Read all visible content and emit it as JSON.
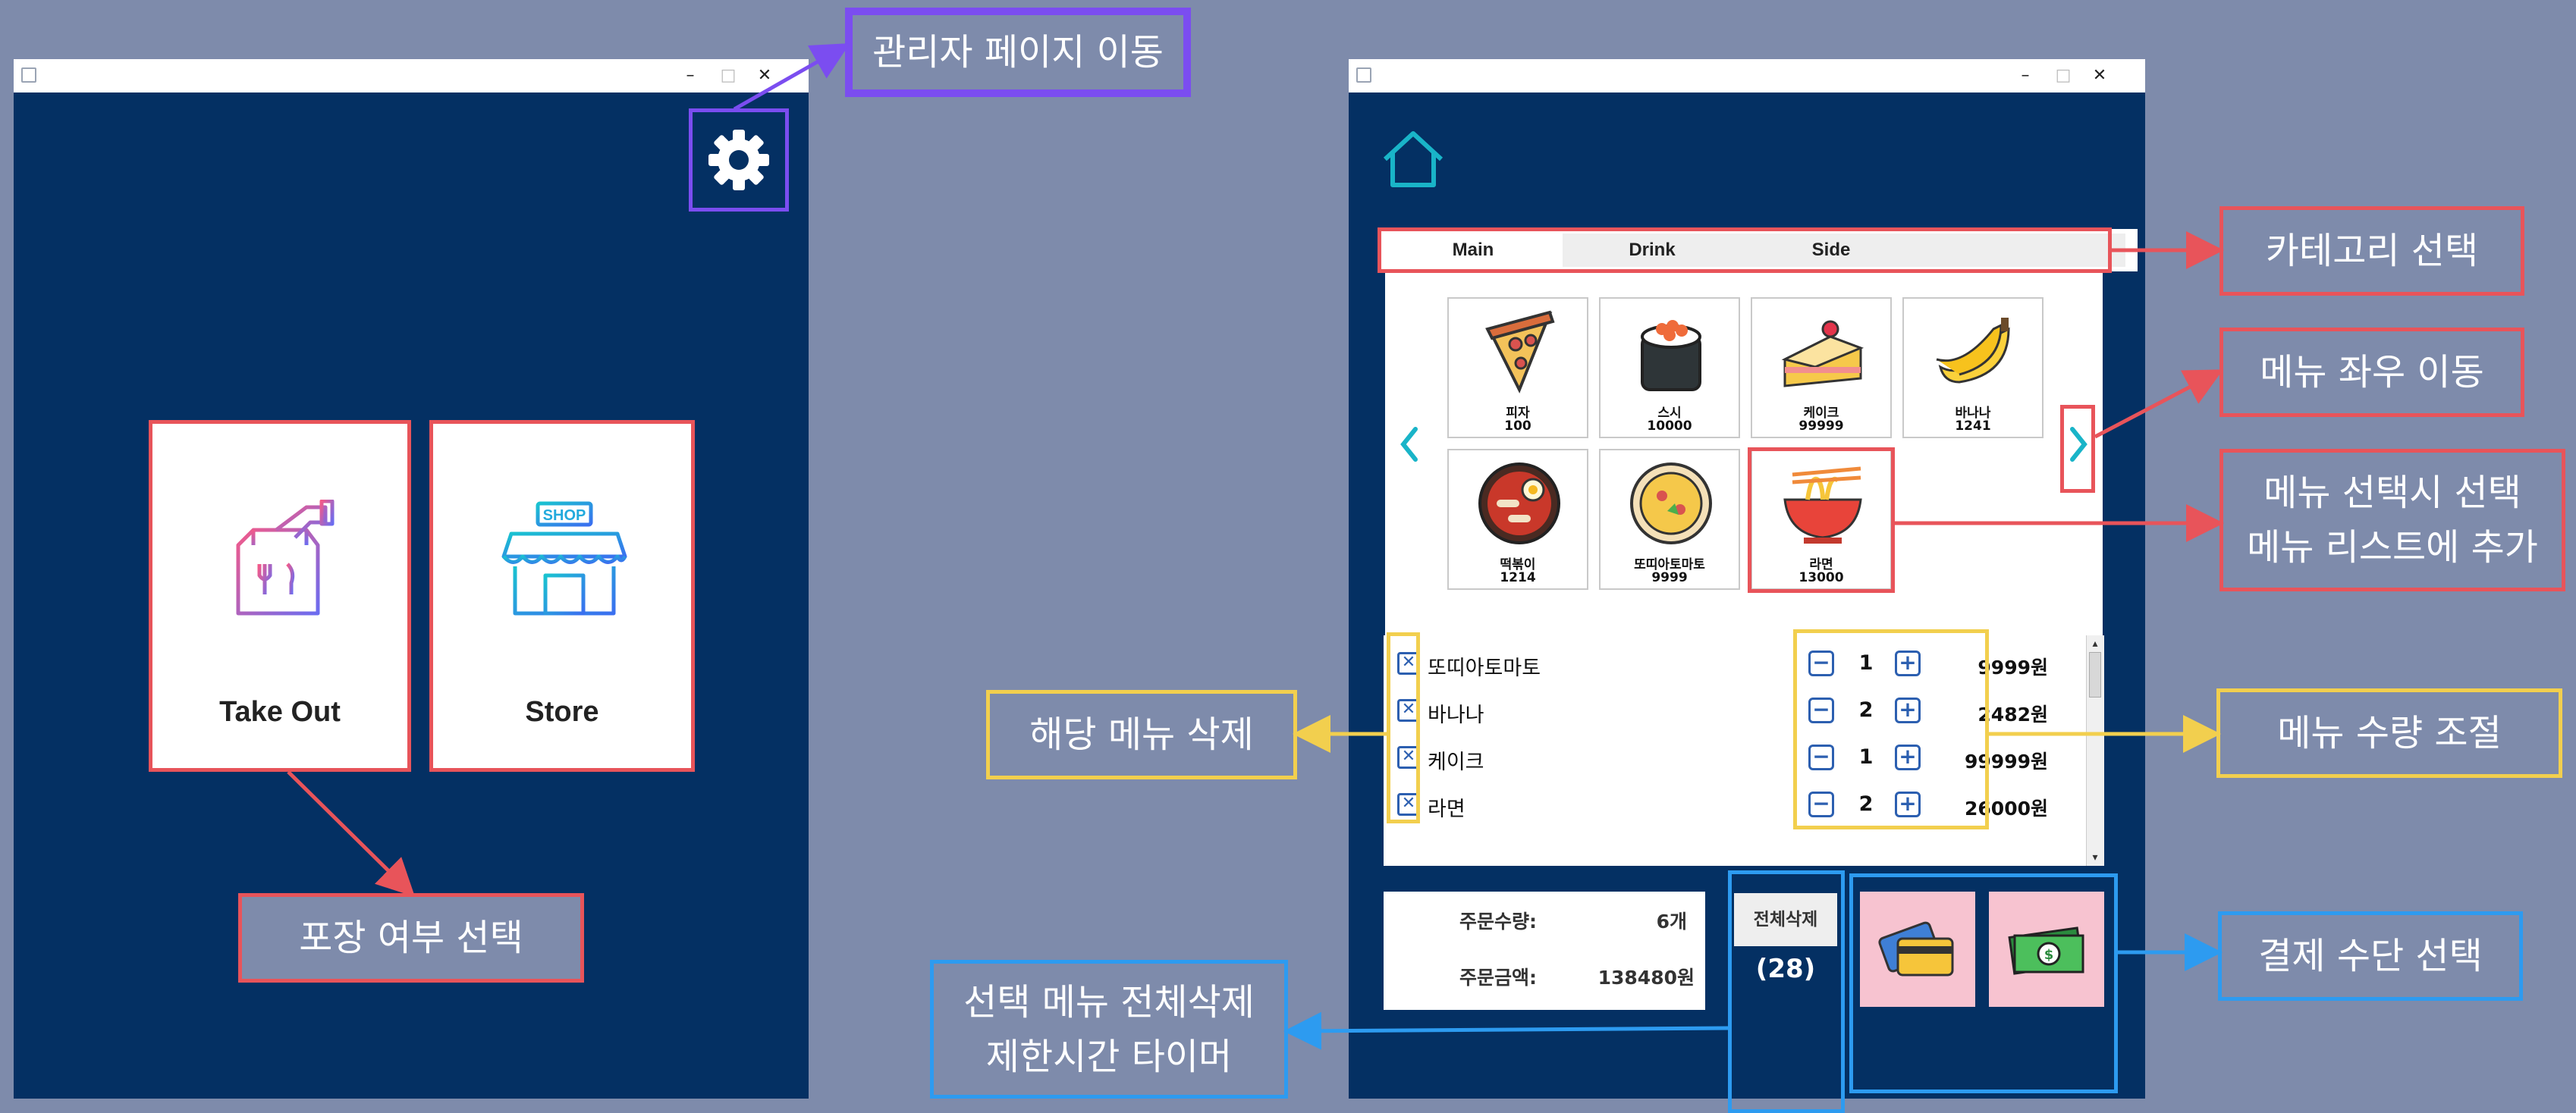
{
  "annotations": {
    "admin": "관리자 페이지 이동",
    "takeout": "포장 여부 선택",
    "category": "카테고리 선택",
    "menu_move": "메뉴 좌우 이동",
    "menu_add": "메뉴 선택시 선택\n메뉴 리스트에 추가",
    "delete_item": "해당 메뉴 삭제",
    "quantity": "메뉴 수량 조절",
    "payment": "결제 수단 선택",
    "clear_timer": "선택 메뉴 전체삭제\n제한시간 타이머"
  },
  "window_buttons": {
    "minimize": "–",
    "maximize": "□",
    "close": "✕"
  },
  "main_screen": {
    "takeout_label": "Take Out",
    "store_label": "Store",
    "shop_sign": "SHOP"
  },
  "order_screen": {
    "tabs": [
      "Main",
      "Drink",
      "Side"
    ],
    "menu_items": [
      {
        "name": "피자",
        "price": "100",
        "icon": "pizza-icon"
      },
      {
        "name": "스시",
        "price": "10000",
        "icon": "sushi-icon"
      },
      {
        "name": "케이크",
        "price": "99999",
        "icon": "cake-icon"
      },
      {
        "name": "바나나",
        "price": "1241",
        "icon": "banana-icon"
      },
      {
        "name": "떡볶이",
        "price": "1214",
        "icon": "tteokbokki-icon"
      },
      {
        "name": "또띠아토마토",
        "price": "9999",
        "icon": "tortilla-icon"
      },
      {
        "name": "라면",
        "price": "13000",
        "icon": "ramen-icon"
      }
    ],
    "selected_items": [
      {
        "name": "또띠아토마토",
        "qty": "1",
        "price": "9999원"
      },
      {
        "name": "바나나",
        "qty": "2",
        "price": "2482원"
      },
      {
        "name": "케이크",
        "qty": "1",
        "price": "99999원"
      },
      {
        "name": "라면",
        "qty": "2",
        "price": "26000원"
      }
    ],
    "summary": {
      "count_label": "주문수량:",
      "count_value": "6개",
      "amount_label": "주문금액:",
      "amount_value": "138480원"
    },
    "clear_all_label": "전체삭제",
    "timer": "(28)",
    "delete_symbol": "✕",
    "minus_symbol": "−",
    "plus_symbol": "+"
  },
  "colors": {
    "background": "#7e8bab",
    "window_bg": "#043063",
    "red": "#e8545a",
    "purple": "#7b4df0",
    "yellow": "#f2cf4e",
    "blue": "#2d9bf0",
    "teal": "#19b4c8",
    "pink": "#f7c3d0"
  }
}
